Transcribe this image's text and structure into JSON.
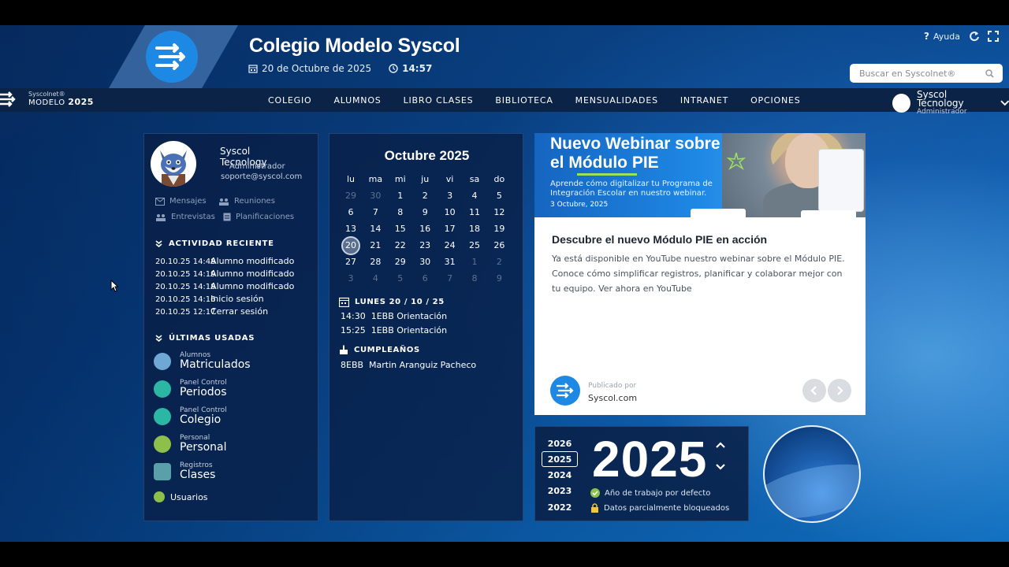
{
  "header": {
    "school_title": "Colegio Modelo Syscol",
    "date": "20 de Octubre de 2025",
    "time": "14:57",
    "help_label": "Ayuda",
    "search_placeholder": "Buscar en Syscolnet®"
  },
  "brand": {
    "line1": "Syscolnet®",
    "line2_prefix": "MODELO",
    "line2_year": "2025"
  },
  "nav": {
    "items": [
      "COLEGIO",
      "ALUMNOS",
      "LIBRO CLASES",
      "BIBLIOTECA",
      "MENSUALIDADES",
      "INTRANET",
      "OPCIONES"
    ]
  },
  "user": {
    "name": "Syscol Tecnology",
    "role": "Administrador"
  },
  "profile": {
    "name": "Syscol Tecnology",
    "role": "Administrador",
    "email": "soporte@syscol.com",
    "quick_links": [
      "Mensajes",
      "Reuniones",
      "Entrevistas",
      "Planificaciones"
    ]
  },
  "activity": {
    "title": "ACTIVIDAD RECIENTE",
    "rows": [
      {
        "date": "20.10.25 14:48",
        "text": "Alumno modificado"
      },
      {
        "date": "20.10.25 14:19",
        "text": "Alumno modificado"
      },
      {
        "date": "20.10.25 14:18",
        "text": "Alumno modificado"
      },
      {
        "date": "20.10.25 14:16",
        "text": "Inicio sesión"
      },
      {
        "date": "20.10.25 12:17",
        "text": "Cerrar sesión"
      }
    ]
  },
  "recent": {
    "title": "ÚLTIMAS USADAS",
    "items": [
      {
        "small": "Alumnos",
        "big": "Matriculados",
        "color": "#6fa8d6"
      },
      {
        "small": "Panel Control",
        "big": "Periodos",
        "color": "#2bb7a4"
      },
      {
        "small": "Panel Control",
        "big": "Colegio",
        "color": "#2bb7a4"
      },
      {
        "small": "Personal",
        "big": "Personal",
        "color": "#8cc04b"
      },
      {
        "small": "Registros",
        "big": "Clases",
        "color": "#5aa0a8"
      }
    ],
    "users_label": "Usuarios"
  },
  "calendar": {
    "month_title": "Octubre  2025",
    "weekdays": [
      "lu",
      "ma",
      "mi",
      "ju",
      "vi",
      "sa",
      "do"
    ],
    "weeks": [
      [
        "29",
        "30",
        "1",
        "2",
        "3",
        "4",
        "5"
      ],
      [
        "6",
        "7",
        "8",
        "9",
        "10",
        "11",
        "12"
      ],
      [
        "13",
        "14",
        "15",
        "16",
        "17",
        "18",
        "19"
      ],
      [
        "20",
        "21",
        "22",
        "23",
        "24",
        "25",
        "26"
      ],
      [
        "27",
        "28",
        "29",
        "30",
        "31",
        "1",
        "2"
      ],
      [
        "3",
        "4",
        "5",
        "6",
        "7",
        "8",
        "9"
      ]
    ],
    "today": "20",
    "agenda_title": "LUNES 20 / 10 / 25",
    "agenda": [
      {
        "time": "14:30",
        "text": "1EBB Orientación"
      },
      {
        "time": "15:25",
        "text": "1EBB Orientación"
      }
    ],
    "birthday_title": "CUMPLEAÑOS",
    "birthdays": [
      {
        "course": "8EBB",
        "name": "Martin Aranguiz Pacheco"
      }
    ]
  },
  "news": {
    "banner_line1": "Nuevo Webinar sobre",
    "banner_line2_prefix": "el ",
    "banner_line2_highlight": "Módulo PIE",
    "banner_sub": "Aprende cómo digitalizar tu Programa de Integración Escolar en nuestro webinar.",
    "banner_date": "3 Octubre, 2025",
    "title": "Descubre el nuevo Módulo PIE en acción",
    "body": "Ya está disponible en YouTube nuestro webinar sobre el Módulo PIE. Conoce cómo simplificar registros, planificar y colaborar mejor con tu equipo.  Ver ahora en YouTube",
    "published_label": "Publicado por",
    "publisher": "Syscol.com"
  },
  "years": {
    "list": [
      "2026",
      "2025",
      "2024",
      "2023",
      "2022"
    ],
    "selected": "2025",
    "big": "2025",
    "info_default": "Año de trabajo por defecto",
    "info_locked": "Datos parcialmente bloqueados"
  },
  "colors": {
    "accent": "#1e88e5",
    "nav_bg": "#0a2347",
    "panel_bg": "#091e44",
    "check_green": "#8bc34a",
    "lock_yellow": "#f2c14e"
  }
}
